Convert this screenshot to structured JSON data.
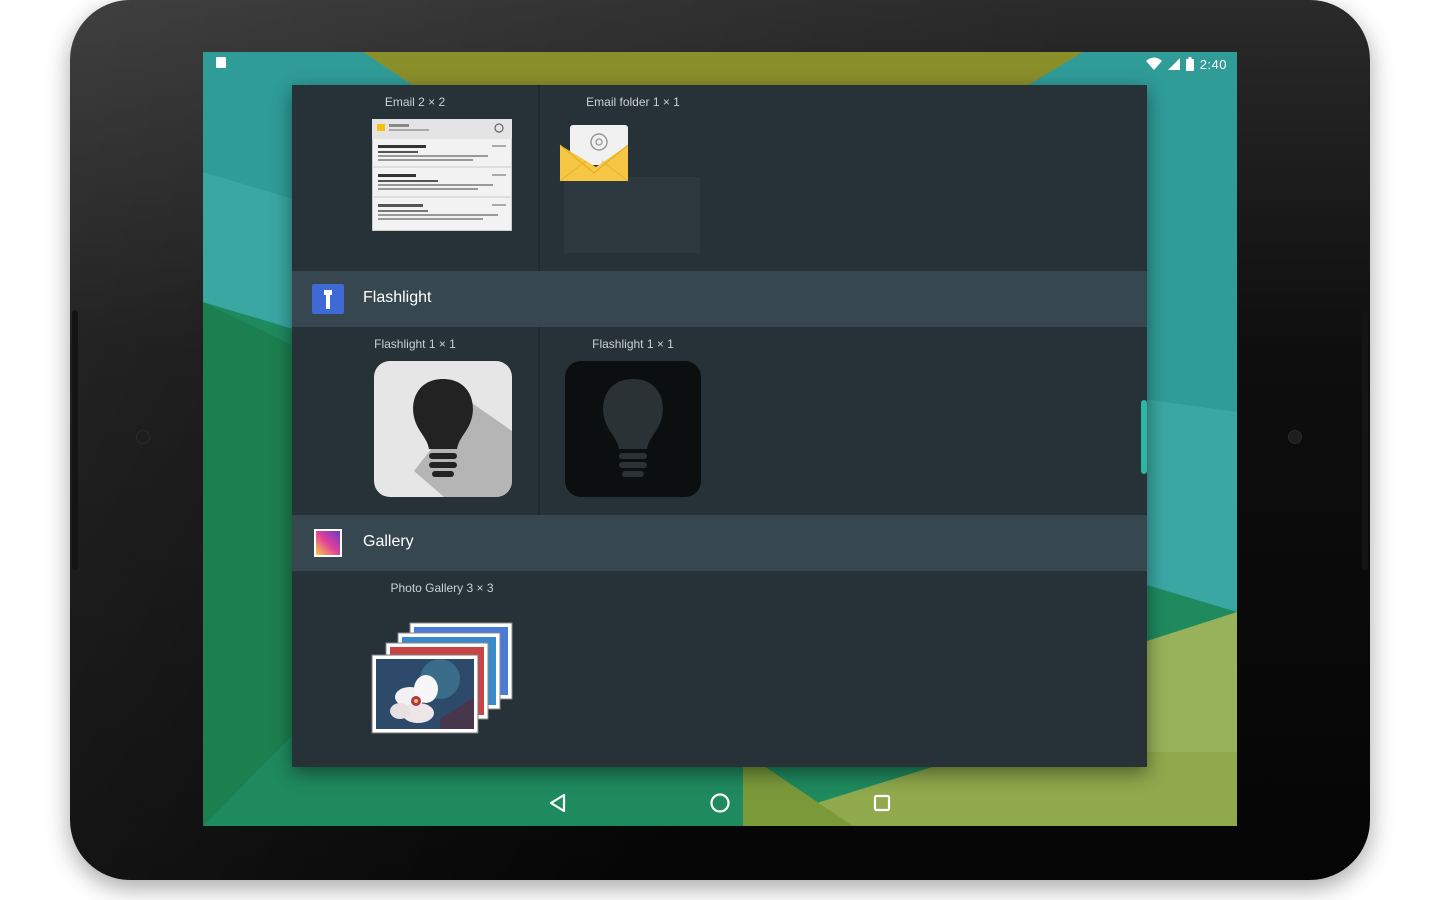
{
  "device": {
    "type": "tablet",
    "orientation": "landscape"
  },
  "status_bar": {
    "time": "2:40",
    "left_icon": "notification-icon",
    "icons": [
      "wifi-icon",
      "cell-signal-icon",
      "battery-icon"
    ]
  },
  "widget_picker": {
    "sections": [
      {
        "id": "email",
        "header_label": "",
        "widgets": [
          {
            "label": "Email 2 × 2",
            "preview": "email-list-widget-preview"
          },
          {
            "label": "Email folder 1 × 1",
            "preview": "email-folder-widget-preview"
          }
        ]
      },
      {
        "id": "flashlight",
        "header_label": "Flashlight",
        "header_icon": "flashlight-app-icon",
        "widgets": [
          {
            "label": "Flashlight 1 × 1",
            "preview": "lightbulb-light-widget-preview"
          },
          {
            "label": "Flashlight 1 × 1",
            "preview": "lightbulb-dark-widget-preview"
          }
        ]
      },
      {
        "id": "gallery",
        "header_label": "Gallery",
        "header_icon": "gallery-app-icon",
        "widgets": [
          {
            "label": "Photo Gallery 3 × 3",
            "preview": "photo-stack-widget-preview"
          }
        ]
      }
    ]
  },
  "navigation_bar": {
    "buttons": [
      "back-icon",
      "home-icon",
      "recents-icon"
    ]
  },
  "colors": {
    "picker_background": "#263238",
    "section_header_background": "#37474f",
    "widget_label_text": "#c9d1d4",
    "wallpaper_teal": "#3aa7a3",
    "wallpaper_green": "#1f8a5e",
    "wallpaper_olive": "#8a8f2a",
    "wallpaper_lime": "#97b25a"
  }
}
